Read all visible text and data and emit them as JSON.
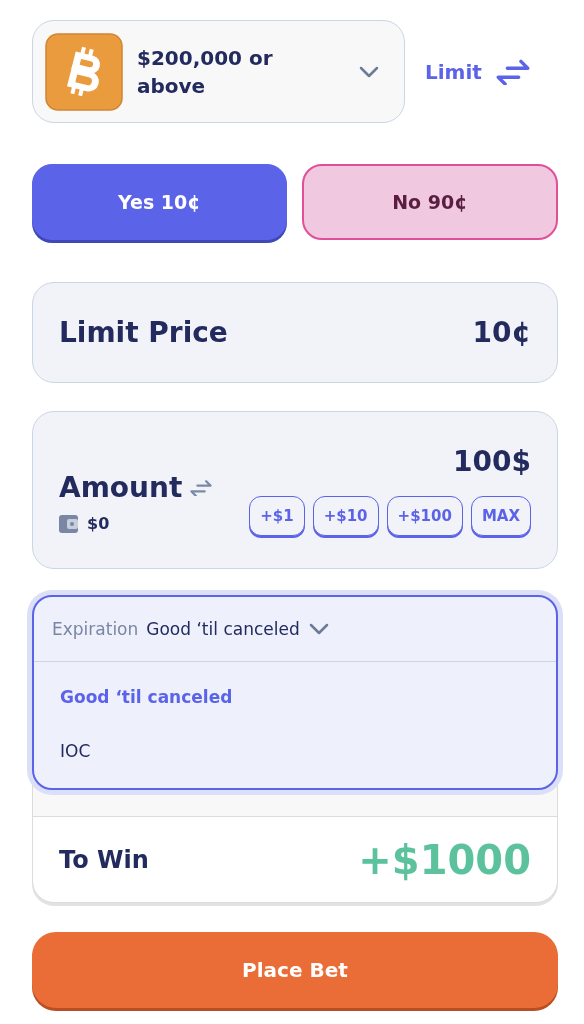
{
  "market": {
    "title": "$200,000 or above"
  },
  "order_type": {
    "label": "Limit"
  },
  "sides": [
    {
      "label": "Yes 10¢",
      "kind": "yes",
      "selected": true
    },
    {
      "label": "No 90¢",
      "kind": "no",
      "selected": false
    }
  ],
  "limit_price": {
    "label": "Limit Price",
    "value": "10¢"
  },
  "amount": {
    "label": "Amount",
    "value": "100$",
    "balance": "$0",
    "quick_add": [
      "+$1",
      "+$10",
      "+$100",
      "MAX"
    ]
  },
  "expiration": {
    "label": "Expiration",
    "value": "Good ‘til canceled",
    "expanded": true,
    "options": [
      {
        "label": "Good ‘til canceled",
        "selected": true
      },
      {
        "label": "IOC",
        "selected": false
      }
    ]
  },
  "to_win": {
    "label": "To Win",
    "value": "+$1000"
  },
  "submit": {
    "label": "Place Bet"
  }
}
